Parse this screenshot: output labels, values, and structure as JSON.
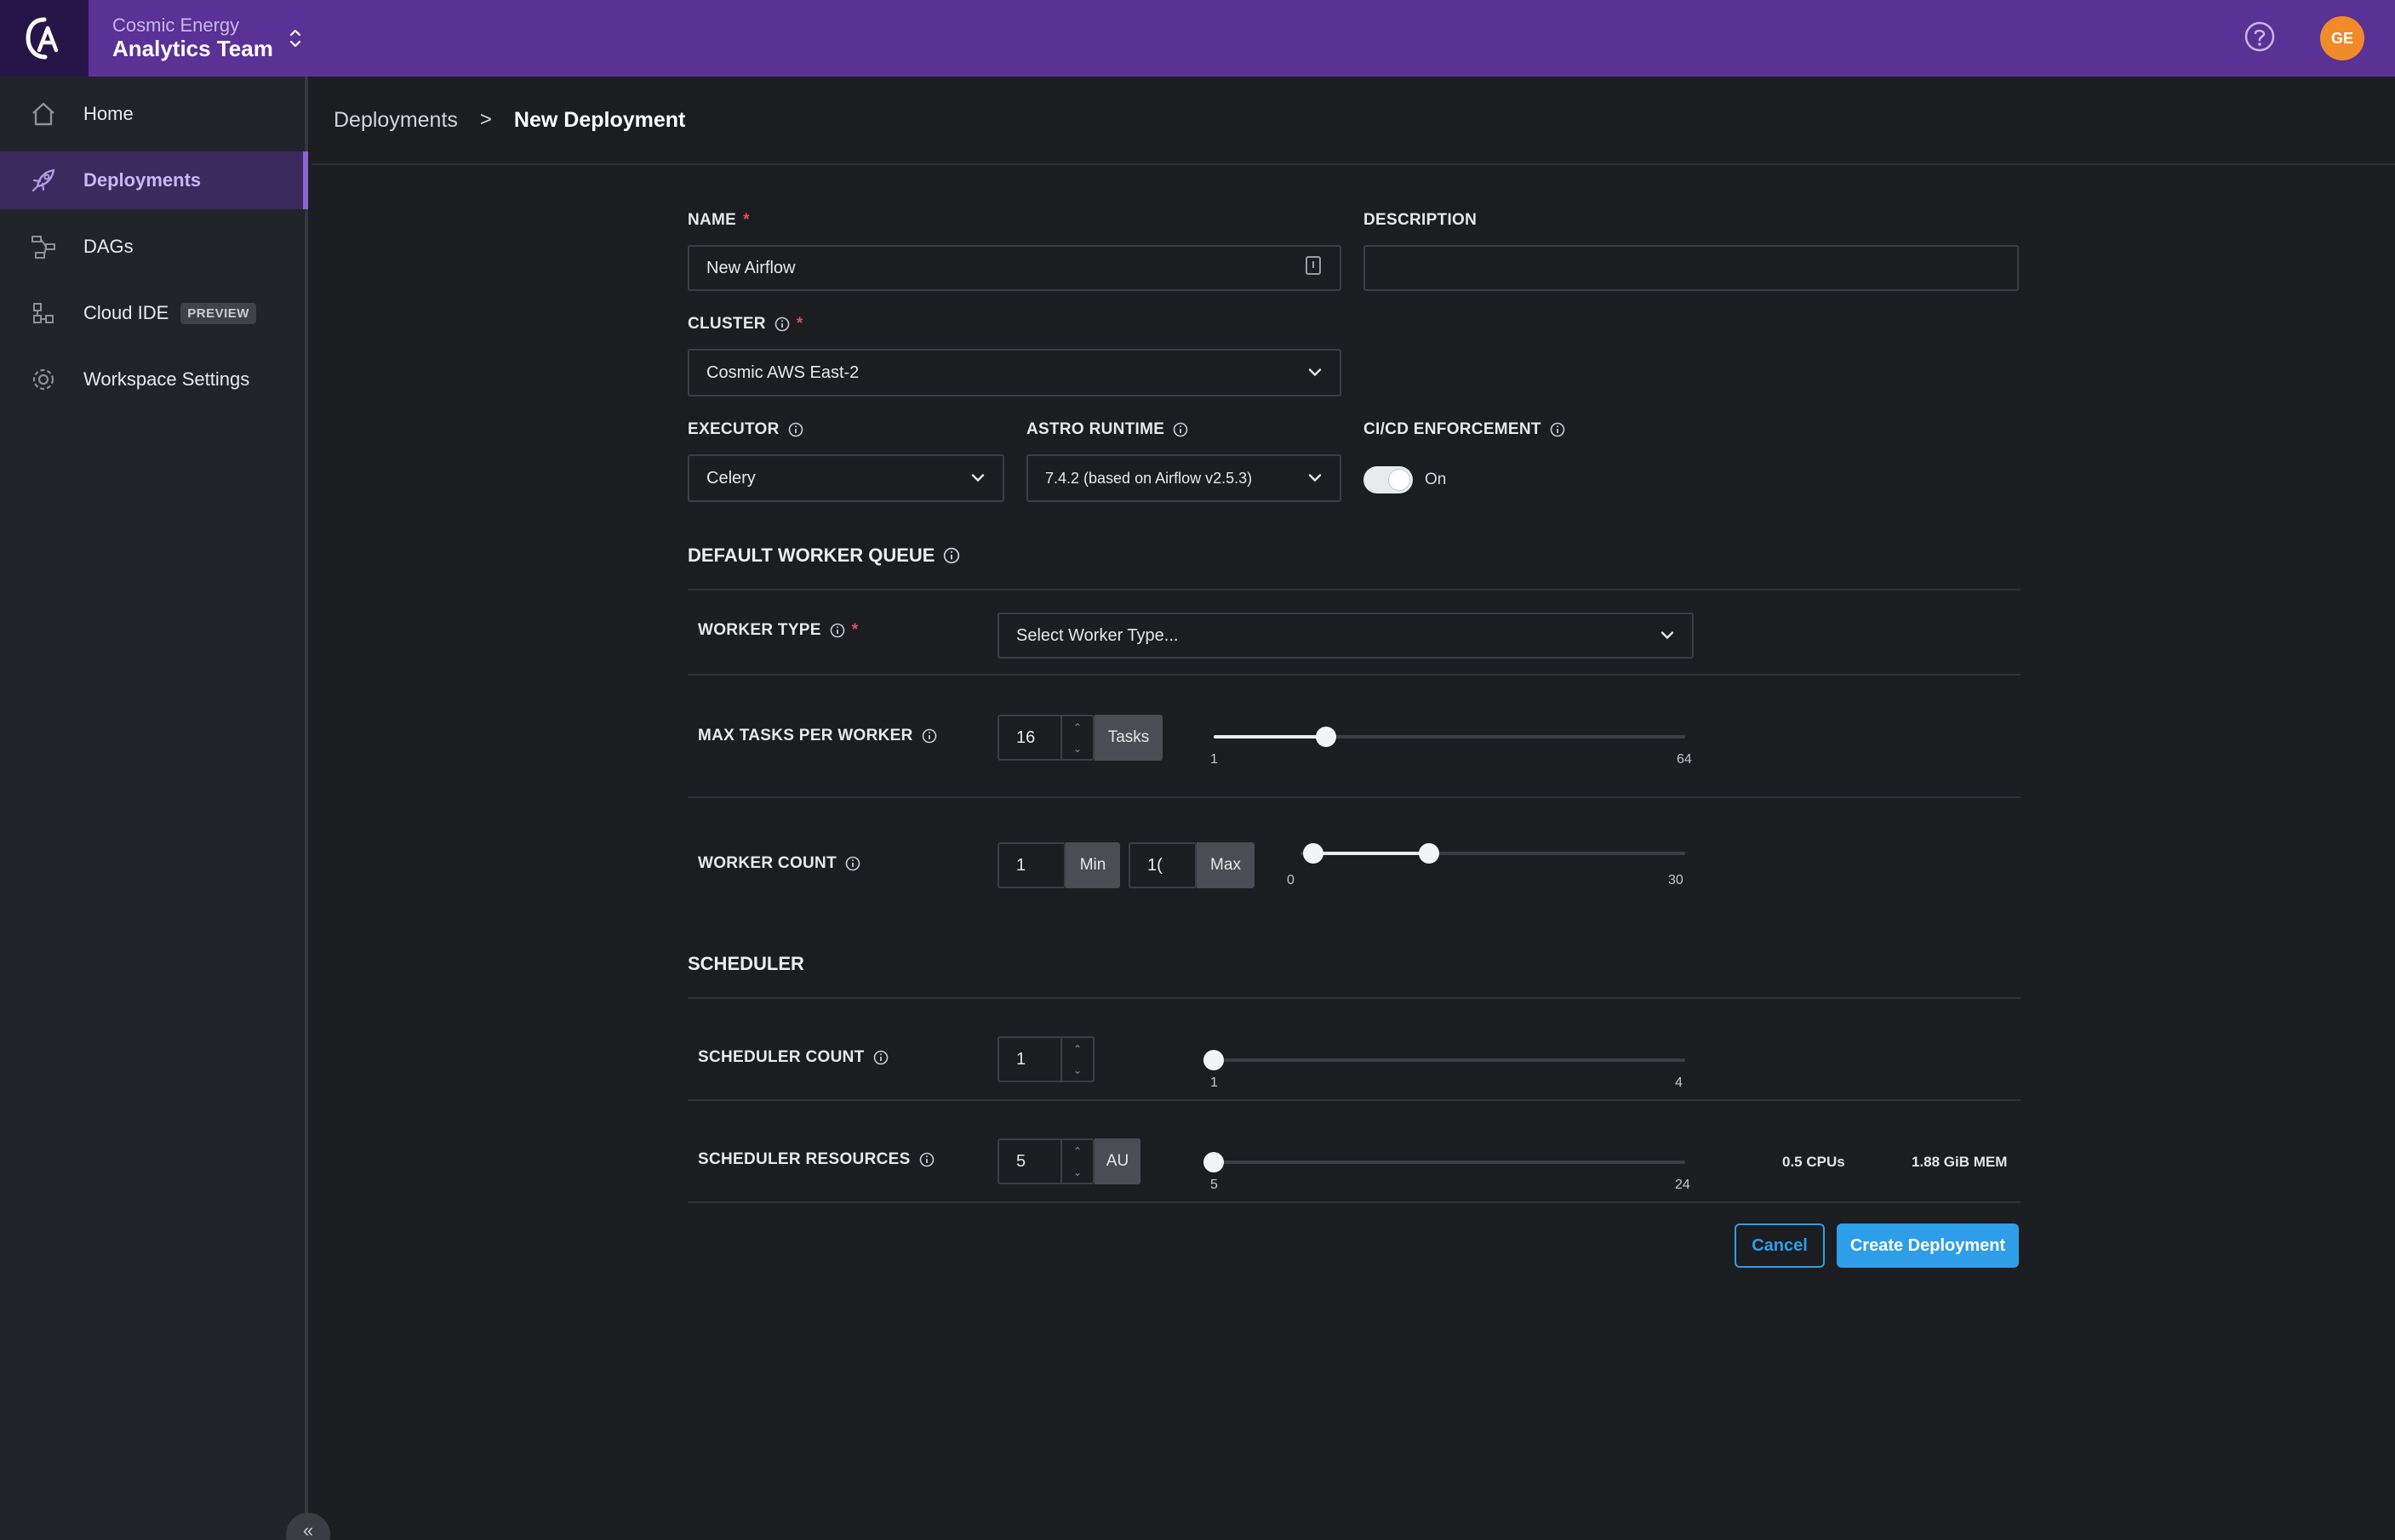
{
  "header": {
    "org_name": "Cosmic Energy",
    "team_name": "Analytics Team",
    "avatar_initials": "GE",
    "accent_color": "#5a3194"
  },
  "sidebar": {
    "items": [
      {
        "label": "Home",
        "icon": "home-icon"
      },
      {
        "label": "Deployments",
        "icon": "rocket-icon",
        "active": true
      },
      {
        "label": "DAGs",
        "icon": "dag-icon"
      },
      {
        "label": "Cloud IDE",
        "icon": "cloud-ide-icon",
        "badge": "PREVIEW"
      },
      {
        "label": "Workspace Settings",
        "icon": "gear-icon"
      }
    ],
    "collapse_glyph": "«"
  },
  "breadcrumb": {
    "parent": "Deployments",
    "separator": ">",
    "current": "New Deployment"
  },
  "form": {
    "name": {
      "label": "NAME",
      "required": "*",
      "value": "New Airflow"
    },
    "description": {
      "label": "DESCRIPTION",
      "value": ""
    },
    "cluster": {
      "label": "CLUSTER",
      "required": "*",
      "value": "Cosmic AWS East-2"
    },
    "executor": {
      "label": "EXECUTOR",
      "value": "Celery"
    },
    "runtime": {
      "label": "ASTRO RUNTIME",
      "value": "7.4.2 (based on Airflow v2.5.3)"
    },
    "cicd": {
      "label": "CI/CD ENFORCEMENT",
      "state": "On",
      "enabled": true
    }
  },
  "worker_queue": {
    "title": "DEFAULT WORKER QUEUE",
    "worker_type": {
      "label": "WORKER TYPE",
      "required": "*",
      "placeholder": "Select Worker Type..."
    },
    "max_tasks": {
      "label": "MAX TASKS PER WORKER",
      "value": "16",
      "unit": "Tasks",
      "min": "1",
      "max": "64",
      "current": 16
    },
    "worker_count": {
      "label": "WORKER COUNT",
      "min_value": "1",
      "min_label": "Min",
      "max_value": "1(",
      "max_label": "Max",
      "range_min": "0",
      "range_max": "30",
      "low": 1,
      "high": 10
    }
  },
  "scheduler": {
    "title": "SCHEDULER",
    "count": {
      "label": "SCHEDULER COUNT",
      "value": "1",
      "min": "1",
      "max": "4",
      "current": 1
    },
    "resources": {
      "label": "SCHEDULER RESOURCES",
      "value": "5",
      "unit": "AU",
      "min": "5",
      "max": "24",
      "current": 5,
      "cpus": "0.5 CPUs",
      "mem": "1.88 GiB MEM"
    }
  },
  "actions": {
    "cancel": "Cancel",
    "create": "Create Deployment",
    "primary_color": "#2e9ee8"
  }
}
